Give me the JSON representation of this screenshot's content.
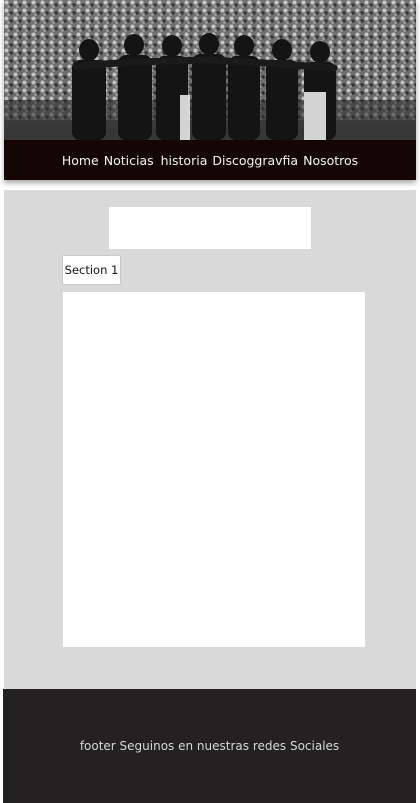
{
  "header": {
    "hero_image": "concert-crowd-photo",
    "nav": {
      "items": [
        {
          "label": "Home"
        },
        {
          "label": "Noticias"
        },
        {
          "label": "historia"
        },
        {
          "label": "Discoggravfia"
        },
        {
          "label": "Nosotros"
        }
      ]
    }
  },
  "main": {
    "section_tab": {
      "label": "Section 1"
    }
  },
  "footer": {
    "text": "footer Seguinos en nuestras redes Sociales"
  },
  "colors": {
    "nav_bg": "#150606",
    "main_bg": "#d9d9d9",
    "footer_bg": "#232121"
  }
}
